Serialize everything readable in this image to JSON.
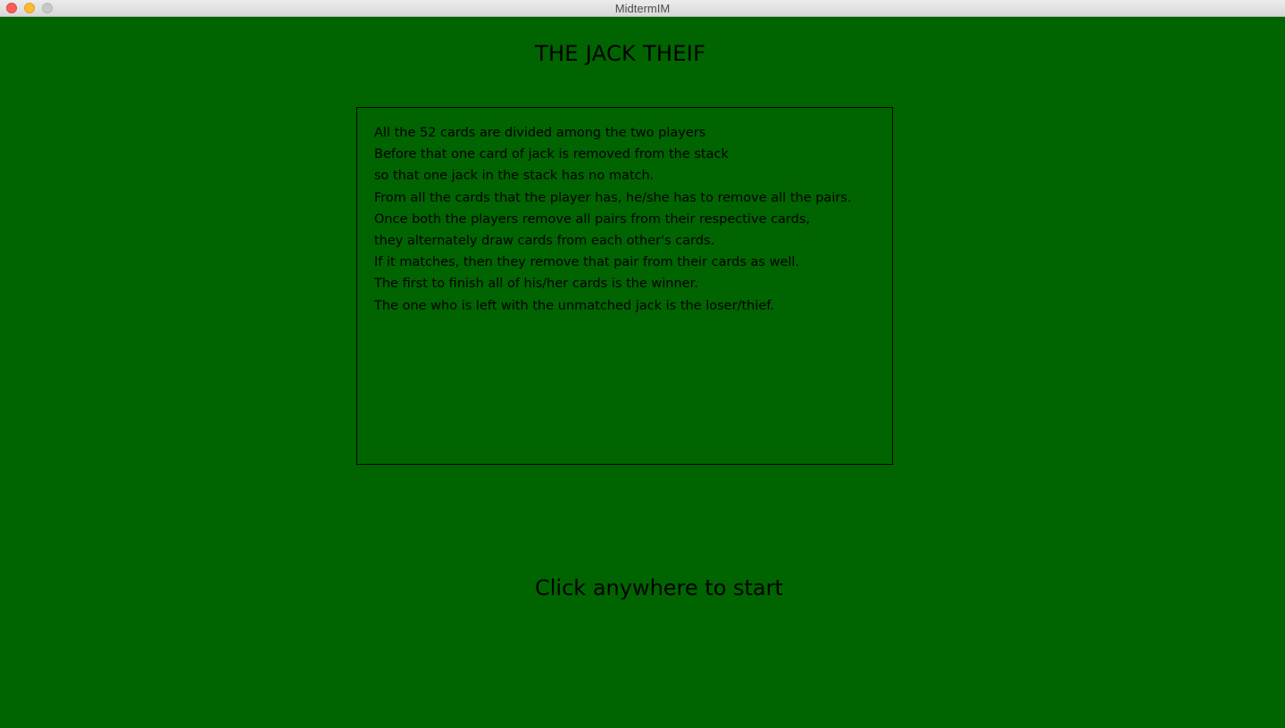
{
  "window": {
    "title": "MidtermIM"
  },
  "game": {
    "title": "THE JACK THEIF",
    "rules": [
      "All the 52 cards are divided among the two players",
      "Before that one card of jack is removed from the stack",
      "so that one jack in the stack has no match.",
      "From all the cards that the player has, he/she has to remove all the pairs.",
      "Once both the players remove all pairs from their respective cards,",
      "they alternately draw cards from each other's cards.",
      "If it matches, then they remove that pair from their cards as well.",
      "The first to finish all of his/her cards is the winner.",
      "The one who is left with the unmatched jack is the loser/thief."
    ],
    "start_prompt": "Click anywhere to start"
  },
  "colors": {
    "background": "#006400",
    "text": "#000000"
  }
}
